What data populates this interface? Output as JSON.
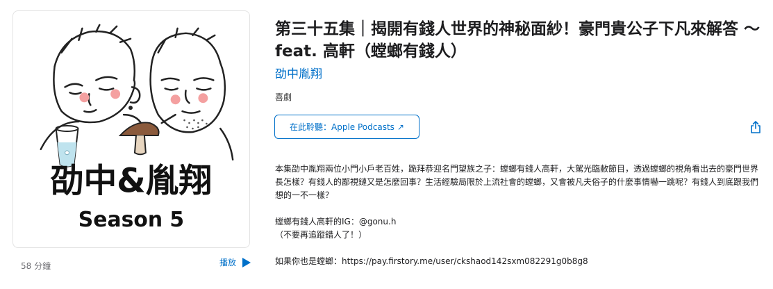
{
  "artwork": {
    "logo_text": "劭中&胤翔",
    "season_text": "Season 5"
  },
  "meta": {
    "duration": "58 分鐘",
    "play_label": "播放"
  },
  "episode": {
    "title": "第三十五集｜揭開有錢人世界的神秘面紗！豪門貴公子下凡來解答 ～ feat. 高軒（螳螂有錢人）",
    "author": "劭中胤翔",
    "category": "喜劇"
  },
  "listen_button": {
    "label": "在此聆聽：Apple Podcasts",
    "arrow": "↗"
  },
  "description": {
    "para1": "本集劭中胤翔兩位小門小戶老百姓，跪拜恭迎名門望族之子：螳螂有錢人高軒，大駕光臨敝節目，透過螳螂的視角看出去的豪門世界長怎樣？有錢人的鄙視鏈又是怎麼回事？生活經驗局限於上流社會的螳螂，又會被凡夫俗子的什麼事情嚇一跳呢？有錢人到底跟我們想的一不一樣？",
    "ig_line": "螳螂有錢人高軒的IG：@gonu.h",
    "ig_note": "（不要再追蹤錯人了！）",
    "link_line": "如果你也是螳螂：https://pay.firstory.me/user/ckshaod142sxm082291g0b8g8"
  },
  "colors": {
    "accent": "#0070c9",
    "text": "#1d1d1f",
    "muted": "#6e6e73"
  }
}
